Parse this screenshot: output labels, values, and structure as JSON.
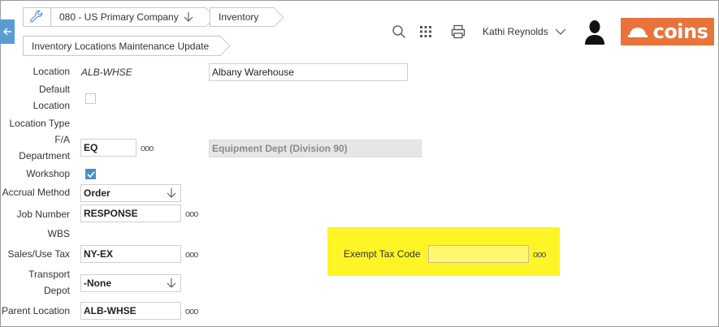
{
  "header": {
    "breadcrumbs": {
      "company": "080 - US Primary Company",
      "module": "Inventory",
      "page": "Inventory Locations Maintenance Update"
    },
    "user_name": "Kathi Reynolds",
    "logo_text": "coins",
    "brand_color": "#e8743b",
    "accent_color": "#5b9bd5"
  },
  "form": {
    "location": {
      "label": "Location",
      "code": "ALB-WHSE",
      "name": "Albany Warehouse"
    },
    "default_location": {
      "label_line1": "Default",
      "label_line2": "Location",
      "checked": false
    },
    "location_type": {
      "label": "Location Type"
    },
    "fa_department": {
      "label_line1": "F/A",
      "label_line2": "Department",
      "value": "EQ",
      "description": "Equipment Dept (Division 90)"
    },
    "workshop": {
      "label": "Workshop",
      "checked": true
    },
    "accrual_method": {
      "label": "Accrual Method",
      "value": "Order"
    },
    "job_number": {
      "label": "Job Number",
      "value": "RESPONSE"
    },
    "wbs": {
      "label": "WBS"
    },
    "sales_use_tax": {
      "label": "Sales/Use Tax",
      "value": "NY-EX"
    },
    "transport_depot": {
      "label_line1": "Transport",
      "label_line2": "Depot",
      "value": "-None"
    },
    "parent_location": {
      "label": "Parent Location",
      "value": "ALB-WHSE"
    },
    "exempt_tax_code": {
      "label": "Exempt Tax Code",
      "value": ""
    }
  },
  "lookup_glyph": "ooo",
  "highlight_color": "#fff200"
}
